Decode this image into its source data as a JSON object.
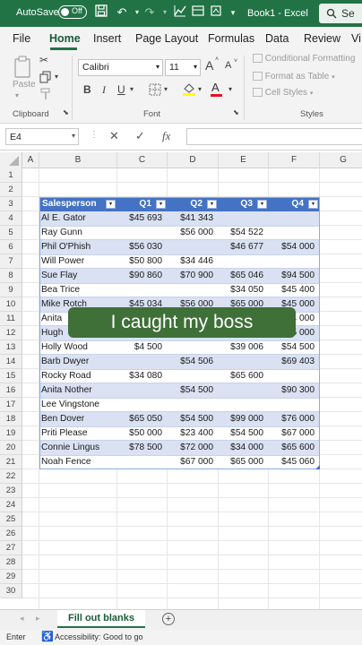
{
  "titlebar": {
    "autosave_label": "AutoSave",
    "toggle_state": "Off",
    "document_title": "Book1  -  Excel",
    "search_label": "Se",
    "accent_color": "#217346"
  },
  "menu": {
    "tabs": [
      "File",
      "Home",
      "Insert",
      "Page Layout",
      "Formulas",
      "Data",
      "Review",
      "Vi"
    ],
    "active": "Home"
  },
  "ribbon": {
    "clipboard": {
      "paste_label": "Paste",
      "group_label": "Clipboard"
    },
    "font": {
      "font_name": "Calibri",
      "font_size": "11",
      "grow_label": "A",
      "shrink_label": "A",
      "bold": "B",
      "italic": "I",
      "underline": "U",
      "font_color_label": "A",
      "group_label": "Font"
    },
    "styles": {
      "conditional_formatting": "Conditional Formatting",
      "format_as_table": "Format as Table",
      "cell_styles": "Cell Styles",
      "group_label": "Styles"
    }
  },
  "formula_bar": {
    "name_box": "E4",
    "cancel_symbol": "✕",
    "enter_symbol": "✓",
    "fx_symbol": "fx",
    "value": ""
  },
  "grid": {
    "columns": [
      "A",
      "B",
      "C",
      "D",
      "E",
      "F",
      "G"
    ],
    "rows": [
      "1",
      "2",
      "3",
      "4",
      "5",
      "6",
      "7",
      "8",
      "9",
      "10",
      "11",
      "12",
      "13",
      "14",
      "15",
      "16",
      "17",
      "18",
      "19",
      "20",
      "21",
      "22",
      "23",
      "24",
      "25",
      "26",
      "27",
      "28",
      "29",
      "30"
    ]
  },
  "table": {
    "headers": [
      "Salesperson",
      "Q1",
      "Q2",
      "Q3",
      "Q4"
    ],
    "header_color": "#4472c4",
    "band_color": "#d9e1f2",
    "rows": [
      [
        "Al E. Gator",
        "$45 693",
        "$41 343",
        "",
        ""
      ],
      [
        "Ray Gunn",
        "",
        "$56 000",
        "$54 522",
        ""
      ],
      [
        "Phil O'Phish",
        "$56 030",
        "",
        "$46 677",
        "$54 000"
      ],
      [
        "Will Power",
        "$50 800",
        "$34 446",
        "",
        ""
      ],
      [
        "Sue Flay",
        "$90 860",
        "$70 900",
        "$65 046",
        "$94 500"
      ],
      [
        "Bea Trice",
        "",
        "",
        "$34 050",
        "$45 400"
      ],
      [
        "Mike Rotch",
        "$45 034",
        "$56 000",
        "$65 000",
        "$45 000"
      ],
      [
        "Anita",
        "",
        "",
        "",
        "$54 000"
      ],
      [
        "Hugh",
        "",
        "",
        "",
        "$65 000"
      ],
      [
        "Holly Wood",
        "$4 500",
        "",
        "$39 006",
        "$54 500"
      ],
      [
        "Barb Dwyer",
        "",
        "$54 506",
        "",
        "$69 403"
      ],
      [
        "Rocky Road",
        "$34 080",
        "",
        "$65 600",
        ""
      ],
      [
        "Anita Nother",
        "",
        "$54 500",
        "",
        "$90 300"
      ],
      [
        "Lee Vingstone",
        "",
        "",
        "",
        ""
      ],
      [
        "Ben Dover",
        "$65 050",
        "$54 500",
        "$99 000",
        "$76 000"
      ],
      [
        "Priti Please",
        "$50 000",
        "$23 400",
        "$54 500",
        "$67 000"
      ],
      [
        "Connie Lingus",
        "$78 500",
        "$72 000",
        "$34 000",
        "$65 600"
      ],
      [
        "Noah Fence",
        "",
        "$67 000",
        "$65 000",
        "$45 060"
      ]
    ]
  },
  "overlay": {
    "caption": "I caught my boss",
    "color": "#3e7038"
  },
  "sheet_tabs": {
    "active_tab": "Fill out blanks",
    "add_symbol": "+"
  },
  "status_bar": {
    "mode": "Enter",
    "accessibility": "Accessibility: Good to go"
  }
}
